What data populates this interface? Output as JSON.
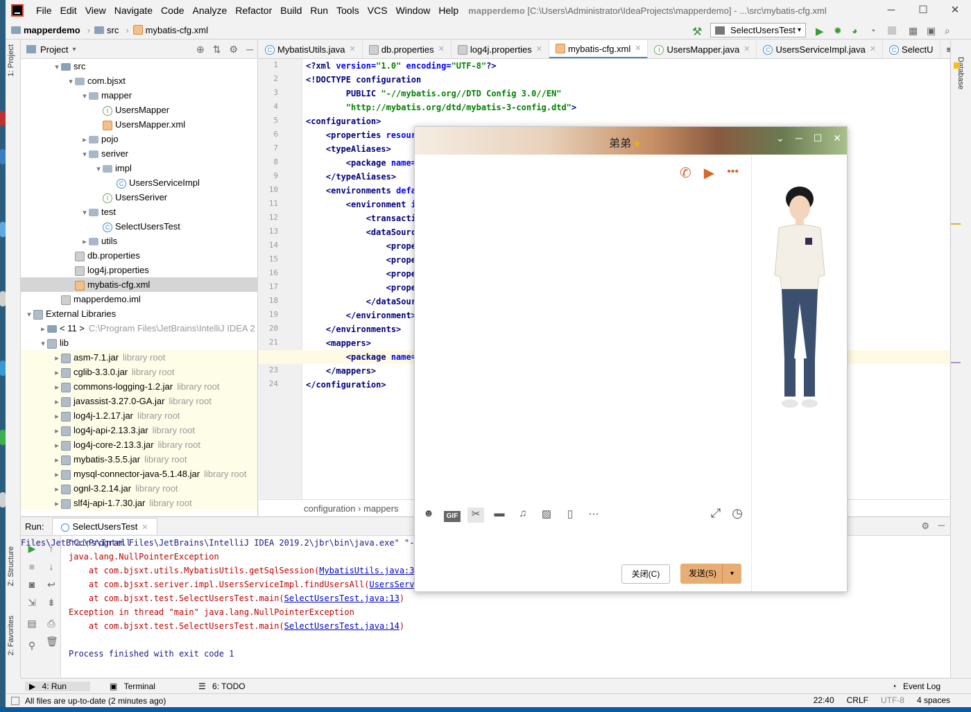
{
  "menu": {
    "items": [
      "File",
      "Edit",
      "View",
      "Navigate",
      "Code",
      "Analyze",
      "Refactor",
      "Build",
      "Run",
      "Tools",
      "VCS",
      "Window",
      "Help"
    ],
    "title_project": "mapperdemo",
    "title_path": "[C:\\Users\\Administrator\\IdeaProjects\\mapperdemo] - ...\\src\\mybatis-cfg.xml"
  },
  "nav": {
    "crumbs": [
      "mapperdemo",
      "src",
      "mybatis-cfg.xml"
    ],
    "run_config": "SelectUsersTest"
  },
  "project": {
    "title": "Project",
    "tree": [
      {
        "label": "src",
        "indent": 2,
        "arrow": "▾",
        "icon": "folder"
      },
      {
        "label": "com.bjsxt",
        "indent": 3,
        "arrow": "▾",
        "icon": "pkg"
      },
      {
        "label": "mapper",
        "indent": 4,
        "arrow": "▾",
        "icon": "pkg"
      },
      {
        "label": "UsersMapper",
        "indent": 5,
        "arrow": "",
        "icon": "iface"
      },
      {
        "label": "UsersMapper.xml",
        "indent": 5,
        "arrow": "",
        "icon": "xml"
      },
      {
        "label": "pojo",
        "indent": 4,
        "arrow": "▸",
        "icon": "pkg"
      },
      {
        "label": "seriver",
        "indent": 4,
        "arrow": "▾",
        "icon": "pkg"
      },
      {
        "label": "impl",
        "indent": 5,
        "arrow": "▾",
        "icon": "pkg"
      },
      {
        "label": "UsersServiceImpl",
        "indent": 6,
        "arrow": "",
        "icon": "cls"
      },
      {
        "label": "UsersSeriver",
        "indent": 5,
        "arrow": "",
        "icon": "iface"
      },
      {
        "label": "test",
        "indent": 4,
        "arrow": "▾",
        "icon": "pkg"
      },
      {
        "label": "SelectUsersTest",
        "indent": 5,
        "arrow": "",
        "icon": "cls"
      },
      {
        "label": "utils",
        "indent": 4,
        "arrow": "▸",
        "icon": "pkg"
      },
      {
        "label": "db.properties",
        "indent": 3,
        "arrow": "",
        "icon": "prop"
      },
      {
        "label": "log4j.properties",
        "indent": 3,
        "arrow": "",
        "icon": "prop"
      },
      {
        "label": "mybatis-cfg.xml",
        "indent": 3,
        "arrow": "",
        "icon": "xml",
        "selected": true
      },
      {
        "label": "mapperdemo.iml",
        "indent": 2,
        "arrow": "",
        "icon": "prop"
      },
      {
        "label": "External Libraries",
        "indent": 0,
        "arrow": "▾",
        "icon": "jar"
      },
      {
        "label": "< 11 >",
        "indent": 1,
        "arrow": "▸",
        "icon": "folder",
        "muted": "C:\\Program Files\\JetBrains\\IntelliJ IDEA 2"
      },
      {
        "label": "lib",
        "indent": 1,
        "arrow": "▾",
        "icon": "jar"
      },
      {
        "label": "asm-7.1.jar",
        "indent": 2,
        "arrow": "▸",
        "icon": "jar",
        "muted": "library root",
        "lib": true
      },
      {
        "label": "cglib-3.3.0.jar",
        "indent": 2,
        "arrow": "▸",
        "icon": "jar",
        "muted": "library root",
        "lib": true
      },
      {
        "label": "commons-logging-1.2.jar",
        "indent": 2,
        "arrow": "▸",
        "icon": "jar",
        "muted": "library root",
        "lib": true
      },
      {
        "label": "javassist-3.27.0-GA.jar",
        "indent": 2,
        "arrow": "▸",
        "icon": "jar",
        "muted": "library root",
        "lib": true
      },
      {
        "label": "log4j-1.2.17.jar",
        "indent": 2,
        "arrow": "▸",
        "icon": "jar",
        "muted": "library root",
        "lib": true
      },
      {
        "label": "log4j-api-2.13.3.jar",
        "indent": 2,
        "arrow": "▸",
        "icon": "jar",
        "muted": "library root",
        "lib": true
      },
      {
        "label": "log4j-core-2.13.3.jar",
        "indent": 2,
        "arrow": "▸",
        "icon": "jar",
        "muted": "library root",
        "lib": true
      },
      {
        "label": "mybatis-3.5.5.jar",
        "indent": 2,
        "arrow": "▸",
        "icon": "jar",
        "muted": "library root",
        "lib": true
      },
      {
        "label": "mysql-connector-java-5.1.48.jar",
        "indent": 2,
        "arrow": "▸",
        "icon": "jar",
        "muted": "library root",
        "lib": true
      },
      {
        "label": "ognl-3.2.14.jar",
        "indent": 2,
        "arrow": "▸",
        "icon": "jar",
        "muted": "library root",
        "lib": true
      },
      {
        "label": "slf4j-api-1.7.30.jar",
        "indent": 2,
        "arrow": "▸",
        "icon": "jar",
        "muted": "library root",
        "lib": true
      }
    ]
  },
  "tabs": [
    "MybatisUtils.java",
    "db.properties",
    "log4j.properties",
    "mybatis-cfg.xml",
    "UsersMapper.java",
    "UsersServiceImpl.java",
    "SelectU"
  ],
  "tab_icons": [
    "cls",
    "prop",
    "prop",
    "xml",
    "iface",
    "cls",
    "cls"
  ],
  "active_tab": 3,
  "code": [
    [
      [
        "tag",
        "<?xml "
      ],
      [
        "attr",
        "version="
      ],
      [
        "str",
        "\"1.0\""
      ],
      [
        "attr",
        " encoding="
      ],
      [
        "str",
        "\"UTF-8\""
      ],
      [
        "tag",
        "?>"
      ]
    ],
    [
      [
        "tag",
        "<!DOCTYPE configuration"
      ]
    ],
    [
      [
        "",
        "        "
      ],
      [
        "tag",
        "PUBLIC "
      ],
      [
        "str",
        "\"-//mybatis.org//DTD Config 3.0//EN\""
      ]
    ],
    [
      [
        "",
        "        "
      ],
      [
        "str",
        "\"http://mybatis.org/dtd/mybatis-3-config.dtd\""
      ],
      [
        "tag",
        ">"
      ]
    ],
    [
      [
        "tag",
        "<configuration>"
      ]
    ],
    [
      [
        "",
        "    "
      ],
      [
        "tag",
        "<properties "
      ],
      [
        "attr",
        "resourc"
      ]
    ],
    [
      [
        "",
        "    "
      ],
      [
        "tag",
        "<typeAliases>"
      ]
    ],
    [
      [
        "",
        "        "
      ],
      [
        "tag",
        "<package "
      ],
      [
        "attr",
        "name="
      ],
      [
        "str",
        "\""
      ]
    ],
    [
      [
        "",
        "    "
      ],
      [
        "tag",
        "</typeAliases>"
      ]
    ],
    [
      [
        "",
        "    "
      ],
      [
        "tag",
        "<environments "
      ],
      [
        "attr",
        "defau"
      ]
    ],
    [
      [
        "",
        "        "
      ],
      [
        "tag",
        "<environment "
      ],
      [
        "attr",
        "id"
      ]
    ],
    [
      [
        "",
        "            "
      ],
      [
        "tag",
        "<transactio"
      ]
    ],
    [
      [
        "",
        "            "
      ],
      [
        "tag",
        "<dataSource"
      ]
    ],
    [
      [
        "",
        "                "
      ],
      [
        "tag",
        "<proper"
      ]
    ],
    [
      [
        "",
        "                "
      ],
      [
        "tag",
        "<proper"
      ]
    ],
    [
      [
        "",
        "                "
      ],
      [
        "tag",
        "<proper"
      ]
    ],
    [
      [
        "",
        "                "
      ],
      [
        "tag",
        "<proper"
      ]
    ],
    [
      [
        "",
        "            "
      ],
      [
        "tag",
        "</dataSourc"
      ]
    ],
    [
      [
        "",
        "        "
      ],
      [
        "tag",
        "</environment>"
      ]
    ],
    [
      [
        "",
        "    "
      ],
      [
        "tag",
        "</environments>"
      ]
    ],
    [
      [
        "",
        "    "
      ],
      [
        "tag",
        "<mappers>"
      ]
    ],
    [
      [
        "",
        "        "
      ],
      [
        "tag",
        "<package "
      ],
      [
        "attr",
        "name="
      ],
      [
        "str",
        "\""
      ]
    ],
    [
      [
        "",
        "    "
      ],
      [
        "tag",
        "</mappers>"
      ]
    ],
    [
      [
        "tag",
        "</configuration>"
      ]
    ]
  ],
  "highlight_line": 22,
  "editor_breadcrumb": "configuration   ›   mappers",
  "run": {
    "label": "Run:",
    "tab": "SelectUsersTest",
    "lines": [
      [
        [
          "black",
          "\"C:\\Program Files\\JetBrains\\IntelliJ IDEA 2019.2\\jbr\\bin\\java.exe\" \"-ja"
        ]
      ],
      [
        [
          "err",
          "java.lang.NullPointerException"
        ]
      ],
      [
        [
          "err",
          "    at com.bjsxt.utils.MybatisUtils.getSqlSession("
        ],
        [
          "lnk",
          "MybatisUtils.java:34"
        ],
        [
          "err",
          ")"
        ]
      ],
      [
        [
          "err",
          "    at com.bjsxt.seriver.impl.UsersServiceImpl.findUsersAll("
        ],
        [
          "lnk",
          "UsersServic"
        ]
      ],
      [
        [
          "err",
          "    at com.bjsxt.test.SelectUsersTest.main("
        ],
        [
          "lnk",
          "SelectUsersTest.java:13"
        ],
        [
          "err",
          ")"
        ]
      ],
      [
        [
          "err",
          "Exception in thread \"main\" java.lang.NullPointerException"
        ]
      ],
      [
        [
          "err",
          "    at com.bjsxt.test.SelectUsersTest.main("
        ],
        [
          "lnk",
          "SelectUsersTest.java:14"
        ],
        [
          "err",
          ")"
        ]
      ],
      [
        [
          "",
          ""
        ]
      ],
      [
        [
          "black",
          "Process finished with exit code 1"
        ]
      ]
    ],
    "right_text": "Files\\JetBrains\\Intell"
  },
  "bottom_tabs": [
    "4: Run",
    "Terminal",
    "6: TODO"
  ],
  "event_log": "Event Log",
  "status": {
    "message": "All files are up-to-date (2 minutes ago)",
    "position": "22:40",
    "line_sep": "CRLF",
    "encoding": "UTF-8",
    "indent": "4 spaces"
  },
  "side_tabs": {
    "project": "1: Project",
    "structure": "Z: Structure",
    "favorites": "2: Favorites",
    "database": "Database"
  },
  "chat": {
    "contact": "弟弟",
    "close_label": "关闭(C)",
    "send_label": "发送(S)"
  },
  "colors": {
    "accent": "#4a88c7",
    "error": "#c00000",
    "send_button": "#e7ad72"
  }
}
